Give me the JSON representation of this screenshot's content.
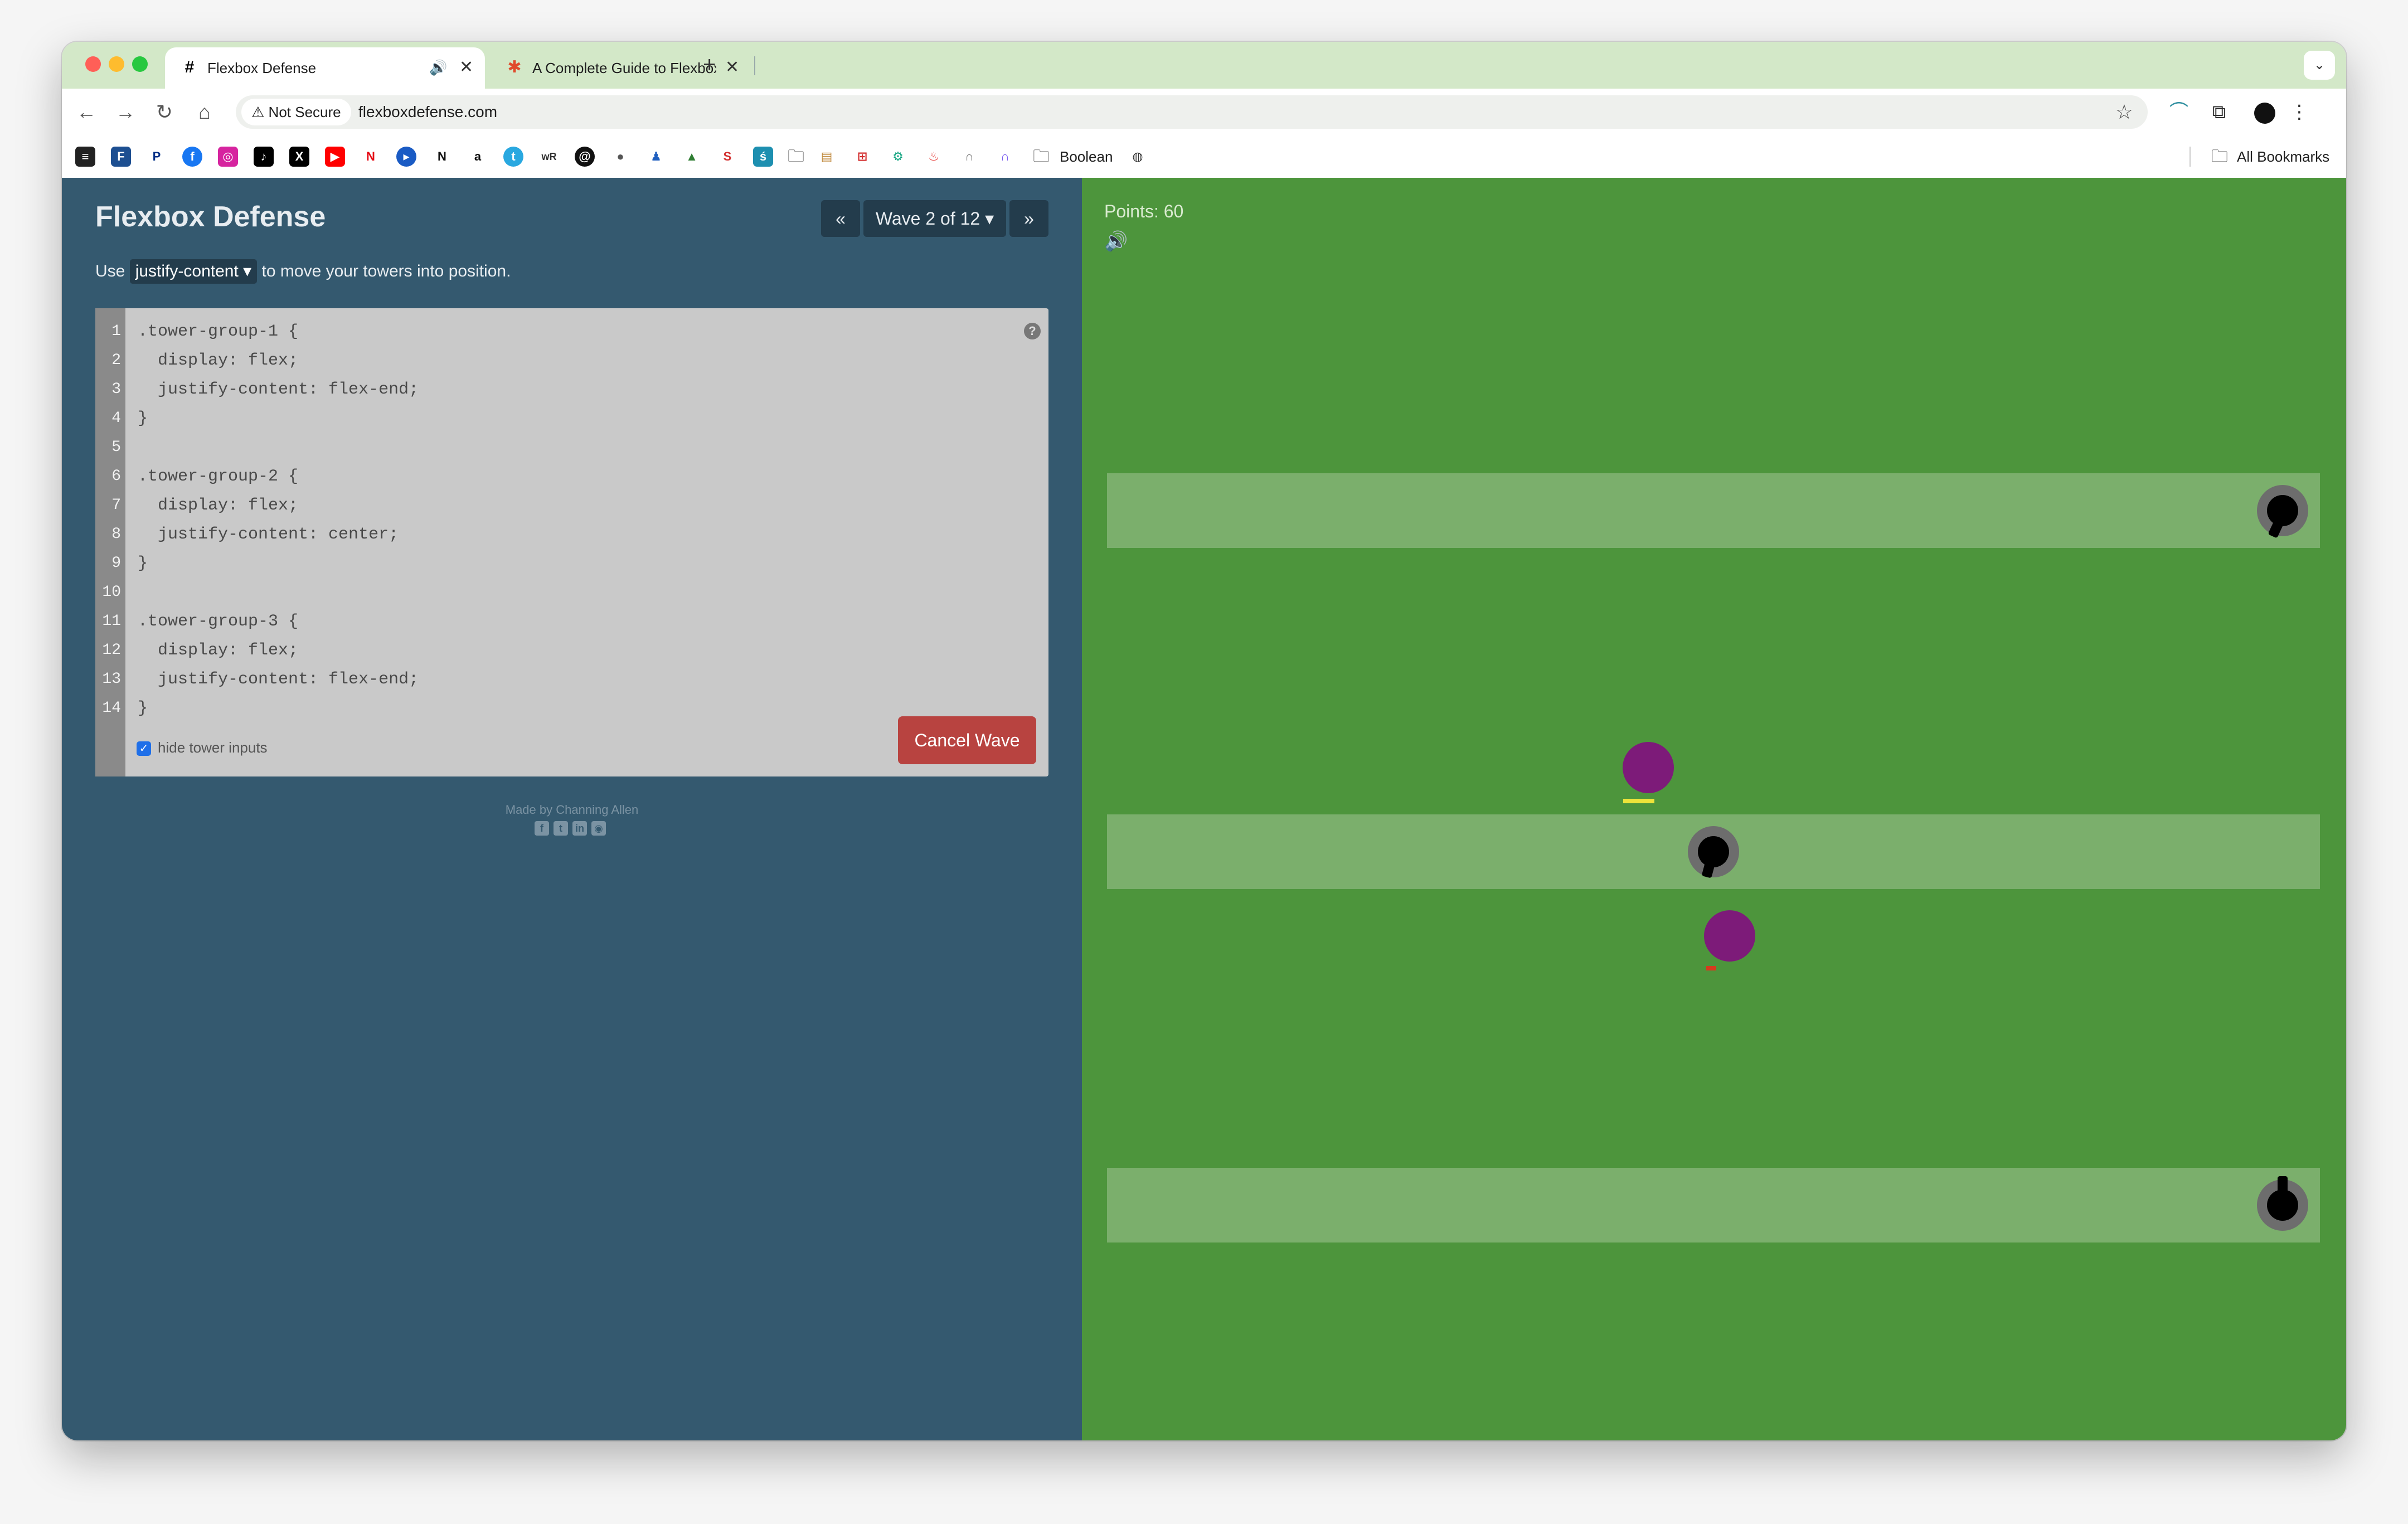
{
  "browser": {
    "tabs": [
      {
        "title": "Flexbox Defense",
        "favicon": "#",
        "active": true
      },
      {
        "title": "A Complete Guide to Flexbox",
        "favicon": "✱",
        "active": false
      }
    ],
    "new_tab_symbol": "+",
    "security_label": "Not Secure",
    "url": "flexboxdefense.com",
    "bookmarks_folder_label": "Boolean",
    "all_bookmarks_label": "All Bookmarks"
  },
  "page": {
    "logo": "Flexbox Defense",
    "wave_label": "Wave 2 of 12",
    "instructions": {
      "prefix": "Use",
      "property": "justify-content",
      "suffix": "to move your towers into position."
    },
    "editor": {
      "line_numbers": [
        "1",
        "2",
        "3",
        "4",
        "5",
        "6",
        "7",
        "8",
        "9",
        "10",
        "11",
        "12",
        "13",
        "14"
      ],
      "lines": [
        ".tower-group-1 {",
        "  display: flex;",
        "  justify-content: flex-end;",
        "}",
        "",
        ".tower-group-2 {",
        "  display: flex;",
        "  justify-content: center;",
        "}",
        "",
        ".tower-group-3 {",
        "  display: flex;",
        "  justify-content: flex-end;",
        "}"
      ],
      "hide_inputs_label": "hide tower inputs",
      "hide_inputs_checked": true,
      "cancel_label": "Cancel Wave"
    },
    "credit": "Made by Channing Allen",
    "social_icons": [
      "facebook-icon",
      "twitter-icon",
      "linkedin-icon",
      "github-icon"
    ]
  },
  "game": {
    "points_label": "Points: 60",
    "colors": {
      "field": "#4d953c",
      "lane": "#7baf6c",
      "enemy": "#7d1b79",
      "panel": "#34596f",
      "cancel": "#b84340"
    }
  }
}
